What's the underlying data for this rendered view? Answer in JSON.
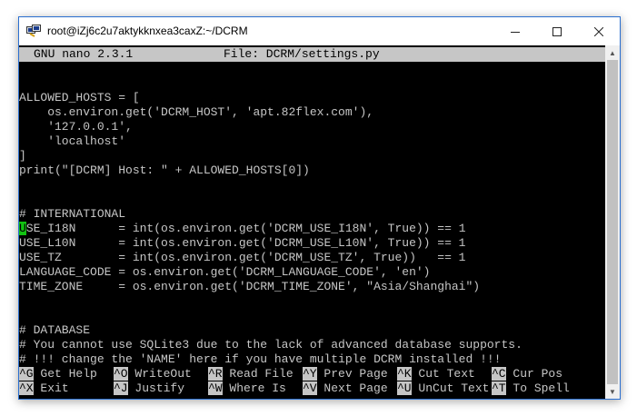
{
  "window": {
    "title": "root@iZj6c2u7aktykknxea3caxZ:~/DCRM",
    "icon": "putty-icon",
    "controls": [
      "minimize-icon",
      "maximize-icon",
      "close-icon"
    ]
  },
  "nano": {
    "version_label": "GNU nano 2.3.1",
    "file_label": "File: DCRM/settings.py"
  },
  "editor": {
    "lines": [
      "",
      "ALLOWED_HOSTS = [",
      "    os.environ.get('DCRM_HOST', 'apt.82flex.com'),",
      "    '127.0.0.1',",
      "    'localhost'",
      "]",
      "print(\"[DCRM] Host: \" + ALLOWED_HOSTS[0])",
      "",
      "",
      "# INTERNATIONAL",
      null,
      "USE_L10N      = int(os.environ.get('DCRM_USE_L10N', True)) == 1",
      "USE_TZ        = int(os.environ.get('DCRM_USE_TZ', True))   == 1",
      "LANGUAGE_CODE = os.environ.get('DCRM_LANGUAGE_CODE', 'en')",
      "TIME_ZONE     = os.environ.get('DCRM_TIME_ZONE', \"Asia/Shanghai\")",
      "",
      "",
      "# DATABASE",
      "# You cannot use SQLite3 due to the lack of advanced database supports.",
      "# !!! change the 'NAME' here if you have multiple DCRM installed !!!"
    ],
    "cursor_line": {
      "cursor_char": "U",
      "rest": "SE_I18N      = int(os.environ.get('DCRM_USE_I18N', True)) == 1"
    }
  },
  "shortcuts": [
    [
      {
        "key": "^G",
        "label": "Get Help"
      },
      {
        "key": "^O",
        "label": "WriteOut"
      },
      {
        "key": "^R",
        "label": "Read File"
      },
      {
        "key": "^Y",
        "label": "Prev Page"
      },
      {
        "key": "^K",
        "label": "Cut Text"
      },
      {
        "key": "^C",
        "label": "Cur Pos"
      }
    ],
    [
      {
        "key": "^X",
        "label": "Exit"
      },
      {
        "key": "^J",
        "label": "Justify"
      },
      {
        "key": "^W",
        "label": "Where Is"
      },
      {
        "key": "^V",
        "label": "Next Page"
      },
      {
        "key": "^U",
        "label": "UnCut Text"
      },
      {
        "key": "^T",
        "label": "To Spell"
      }
    ]
  ],
  "colors": {
    "terminal_bg": "#000000",
    "terminal_fg": "#c6c6c6",
    "cursor": "#12c212",
    "highlight_bg": "#c6c6c6"
  }
}
